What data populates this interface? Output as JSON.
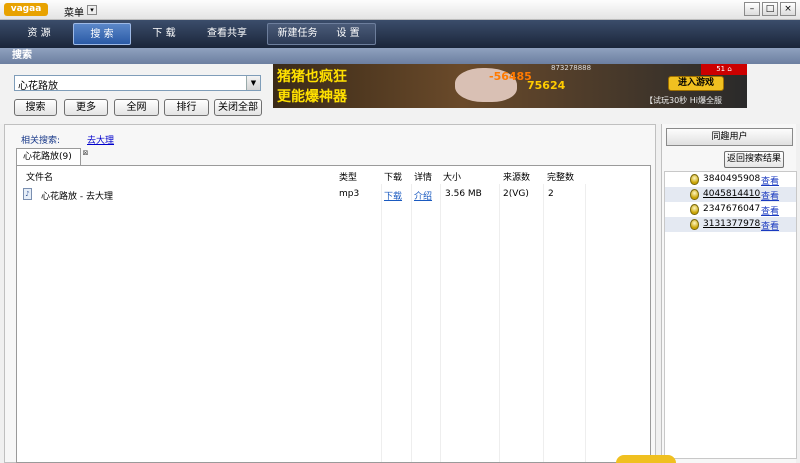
{
  "app": {
    "logo_text": "vagaa",
    "menu_label": "菜单",
    "menu_arrow": "▾",
    "window_buttons": [
      "–",
      "□",
      "×"
    ]
  },
  "nav": {
    "tabs": [
      "资 源",
      "搜 索",
      "下 载",
      "查看共享"
    ],
    "extra": [
      "新建任务",
      "设 置"
    ],
    "active_tab": "搜 索"
  },
  "section_title": "搜索",
  "search": {
    "query": "心花路放",
    "buttons": [
      "搜索",
      "更多",
      "全网",
      "排行",
      "关闭全部"
    ]
  },
  "ad": {
    "line1": "猪猪也疯狂",
    "line2": "更能爆神器",
    "damage1": "-56485",
    "damage2": "75624",
    "player_id": "873278888",
    "cta": "进入游戏",
    "trial": "【试玩30秒  Hi爆全服",
    "corner": "51 ⌂"
  },
  "related": {
    "label": "相关搜索:",
    "link": "去大理"
  },
  "results_tab": {
    "label": "心花路放(9)",
    "close": "⊠"
  },
  "columns": [
    "文件名",
    "类型",
    "下载",
    "详情",
    "大小",
    "来源数",
    "完整数"
  ],
  "rows": [
    {
      "name": "心花路放 - 去大理",
      "type": "mp3",
      "download": "下载",
      "detail": "介绍",
      "size": "3.56 MB",
      "sources": "2(VG)",
      "complete": "2"
    }
  ],
  "right": {
    "header": "同趣用户",
    "back_button": "返回搜索结果",
    "view_label": "查看",
    "users": [
      "3840495908",
      "4045814410",
      "2347676047",
      "3131377978"
    ]
  }
}
